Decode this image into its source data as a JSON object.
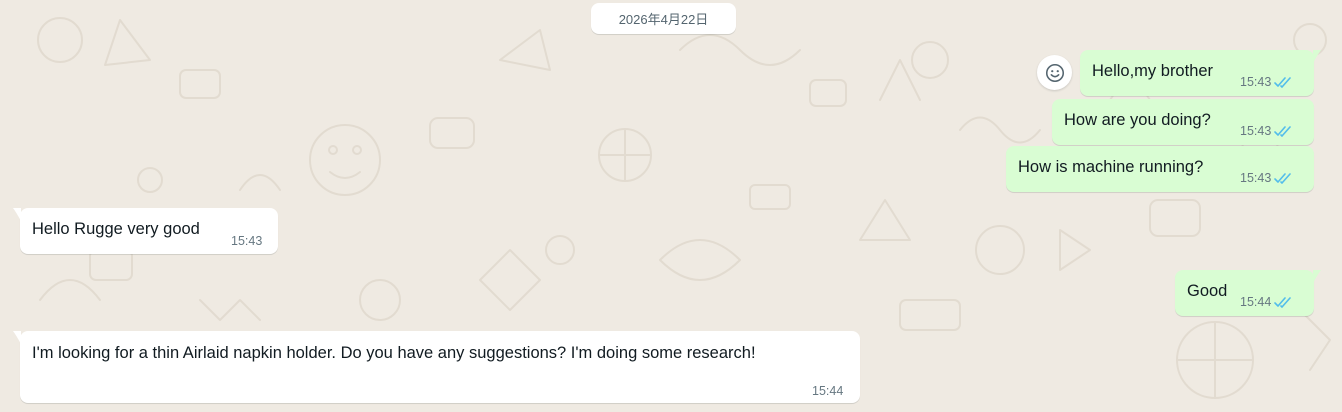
{
  "date_label": "2026年4月22日",
  "colors": {
    "background": "#efeae2",
    "outgoing_bubble": "#d9fdd3",
    "incoming_bubble": "#ffffff",
    "read_tick": "#53bdeb",
    "timestamp": "#667781"
  },
  "icons": {
    "reaction": "smiley-icon",
    "read_receipt": "double-check-icon"
  },
  "messages": [
    {
      "direction": "outgoing",
      "text": "Hello,my brother",
      "time": "15:43",
      "status": "read"
    },
    {
      "direction": "outgoing",
      "text": "How are you doing?",
      "time": "15:43",
      "status": "read"
    },
    {
      "direction": "outgoing",
      "text": "How is machine running?",
      "time": "15:43",
      "status": "read"
    },
    {
      "direction": "incoming",
      "text": "Hello Rugge very good",
      "time": "15:43"
    },
    {
      "direction": "outgoing",
      "text": "Good",
      "time": "15:44",
      "status": "read"
    },
    {
      "direction": "incoming",
      "text": "I'm looking for a thin Airlaid napkin holder. Do you have any suggestions? I'm doing some research!",
      "time": "15:44"
    }
  ]
}
